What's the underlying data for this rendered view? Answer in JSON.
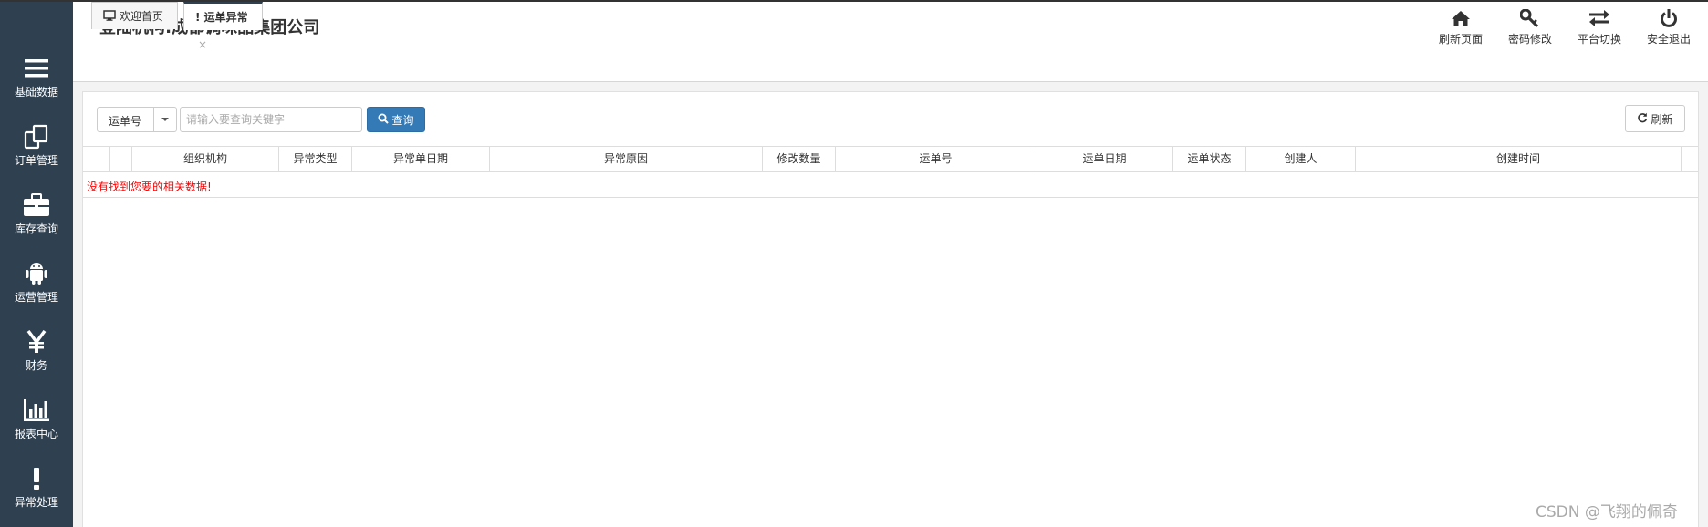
{
  "header": {
    "title": "登陆机构:成都调味品集团公司"
  },
  "header_actions": [
    {
      "label": "刷新页面",
      "icon": "home-icon"
    },
    {
      "label": "密码修改",
      "icon": "key-icon"
    },
    {
      "label": "平台切换",
      "icon": "exchange-icon"
    },
    {
      "label": "安全退出",
      "icon": "power-icon"
    }
  ],
  "sidebar": {
    "items": [
      {
        "label": "基础数据",
        "icon": "bars-icon"
      },
      {
        "label": "订单管理",
        "icon": "copy-icon"
      },
      {
        "label": "库存查询",
        "icon": "briefcase-icon"
      },
      {
        "label": "运营管理",
        "icon": "android-icon"
      },
      {
        "label": "财务",
        "icon": "yen-icon"
      },
      {
        "label": "报表中心",
        "icon": "bar-chart-icon"
      },
      {
        "label": "异常处理",
        "icon": "exclamation-icon"
      }
    ]
  },
  "tabs": [
    {
      "label": "欢迎首页",
      "icon": "desktop-icon",
      "active": false
    },
    {
      "label": "运单异常",
      "icon": "exclamation-icon",
      "active": true,
      "close": "×"
    }
  ],
  "toolbar": {
    "field_select": "运单号",
    "search_placeholder": "请输入要查询关键字",
    "query_label": "查询",
    "refresh_label": "刷新"
  },
  "table": {
    "columns": [
      "组织机构",
      "异常类型",
      "异常单日期",
      "异常原因",
      "修改数量",
      "运单号",
      "运单日期",
      "运单状态",
      "创建人",
      "创建时间"
    ],
    "empty_message": "没有找到您要的相关数据!"
  },
  "watermark": "CSDN @飞翔的佩奇",
  "colors": {
    "sidebar_bg": "#2f4050",
    "primary_button": "#337ab7",
    "empty_text": "#ff0000"
  }
}
